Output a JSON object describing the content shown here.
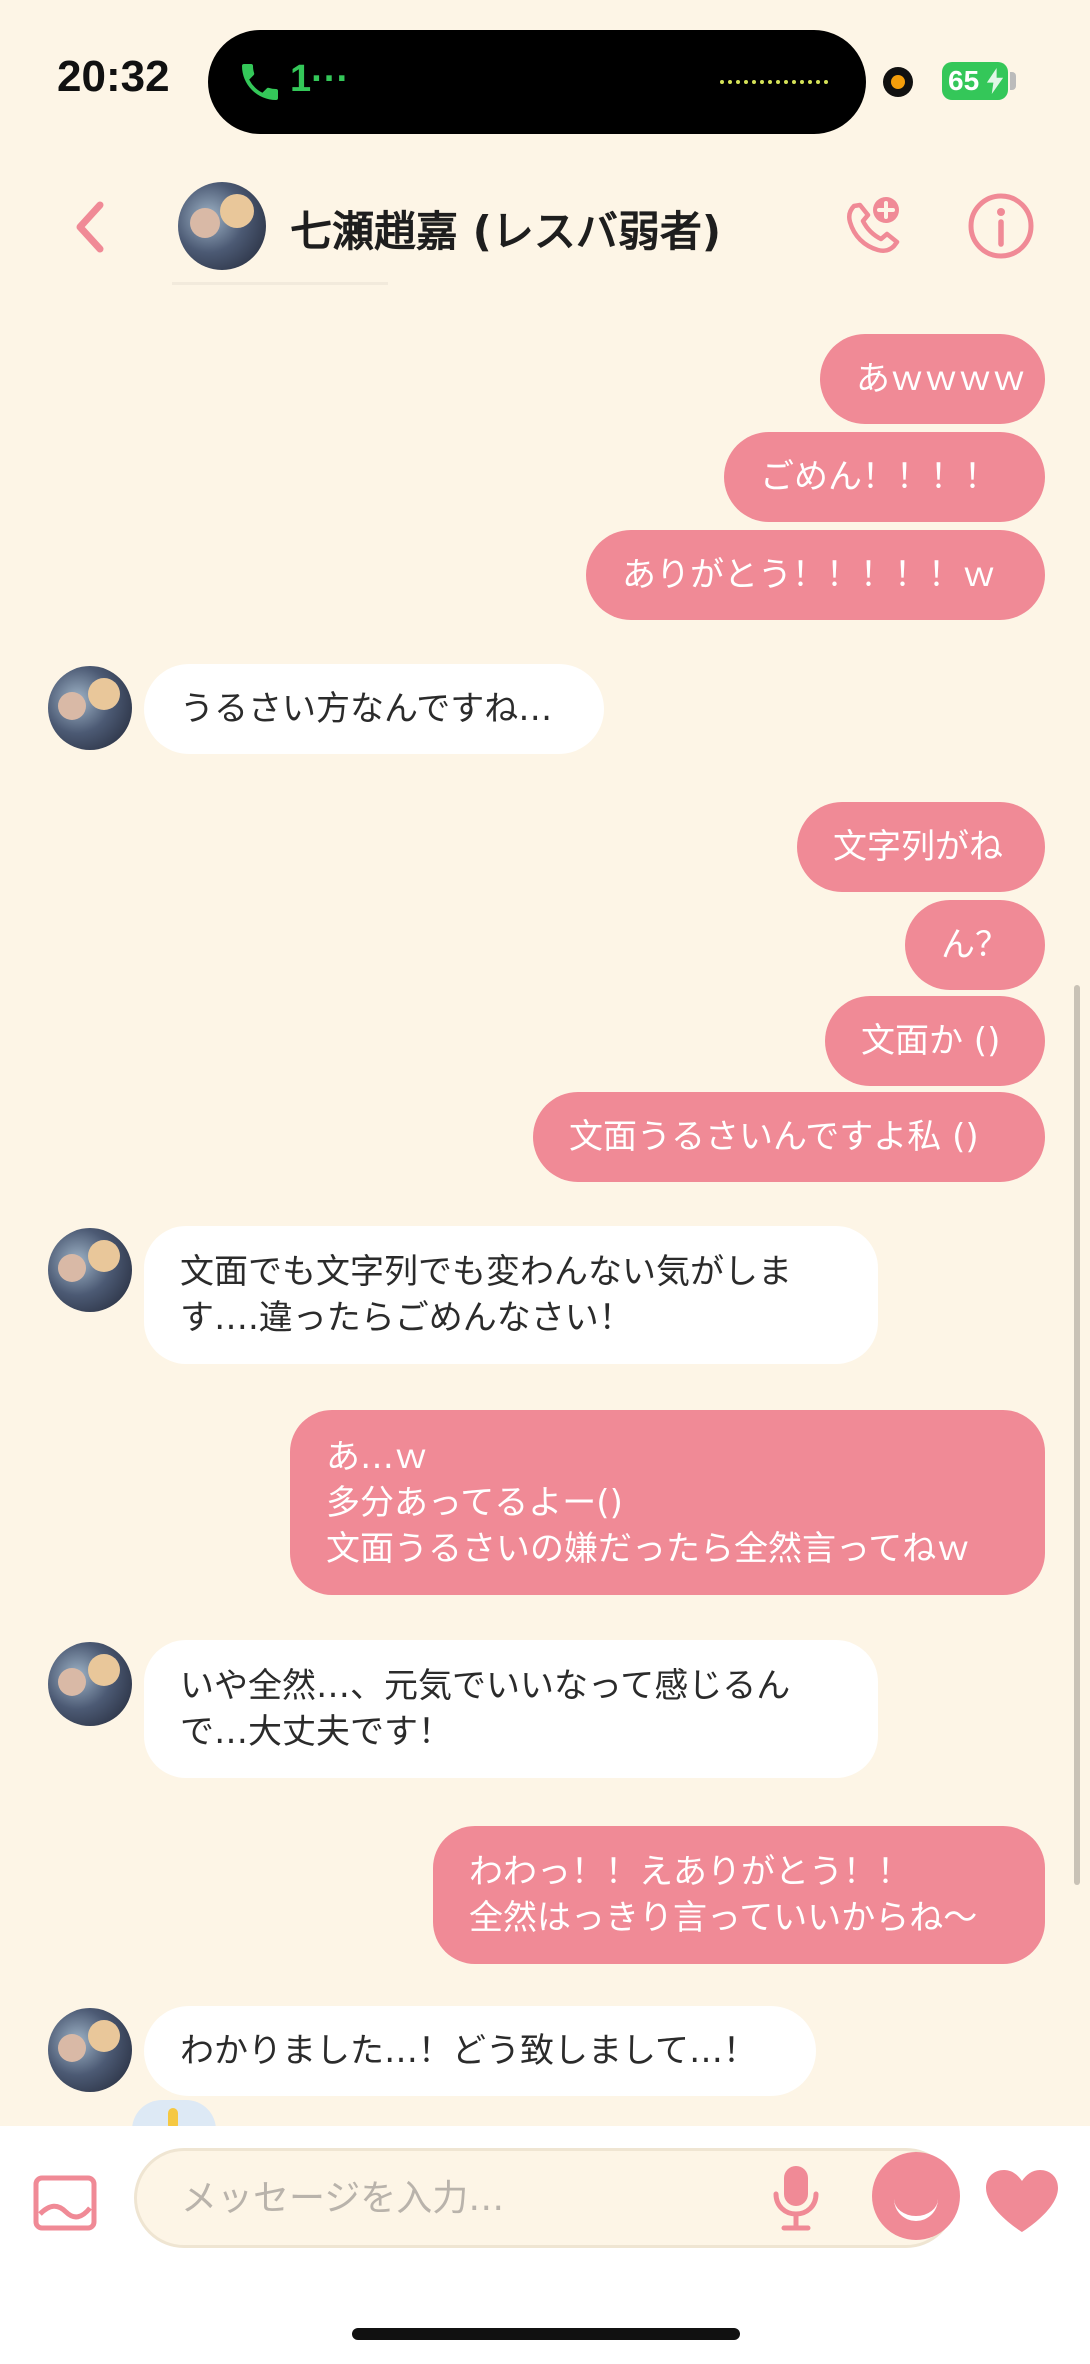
{
  "status_bar": {
    "time": "20:32",
    "call_indicator": "1···",
    "battery_level": "65"
  },
  "header": {
    "contact_name": "七瀬趙嘉 (レスバ弱者)",
    "back_icon": "chevron-left-icon",
    "add_call_icon": "phone-add-icon",
    "info_icon": "info-icon"
  },
  "messages": [
    {
      "direction": "out",
      "text": "あｗｗｗｗ"
    },
    {
      "direction": "out",
      "text": "ごめん！！！！"
    },
    {
      "direction": "out",
      "text": "ありがとう！！！！！ｗ"
    },
    {
      "direction": "in",
      "text": "うるさい方なんですね…"
    },
    {
      "direction": "out",
      "text": "文字列がね"
    },
    {
      "direction": "out",
      "text": "ん？"
    },
    {
      "direction": "out",
      "text": "文面か ()"
    },
    {
      "direction": "out",
      "text": "文面うるさいんですよ私 ()"
    },
    {
      "direction": "in",
      "lines": [
        "文面でも文字列でも変わんない気がしま",
        "す….違ったらごめんなさい！"
      ]
    },
    {
      "direction": "out",
      "lines": [
        "あ…ｗ",
        "多分あってるよー()",
        "文面うるさいの嫌だったら全然言ってねｗ"
      ]
    },
    {
      "direction": "in",
      "lines": [
        "いや全然…、元気でいいなって感じるん",
        "で…大丈夫です！"
      ]
    },
    {
      "direction": "out",
      "lines": [
        "わわっ！！えありがとう！！",
        "全然はっきり言っていいからね〜"
      ]
    },
    {
      "direction": "in",
      "text": "わかりました…！どう致しまして…！"
    }
  ],
  "input": {
    "placeholder": "メッセージを入力…"
  },
  "colors": {
    "background": "#fdf5e6",
    "accent": "#f08a96",
    "incoming_bubble": "#ffffff"
  }
}
